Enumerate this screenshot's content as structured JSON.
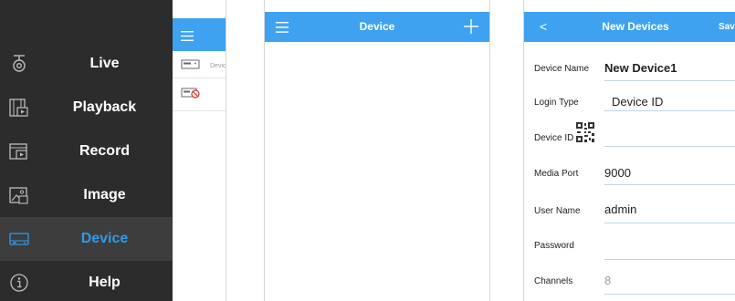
{
  "side_menu": {
    "items": [
      {
        "label": "Live",
        "icon": "live-camera-icon"
      },
      {
        "label": "Playback",
        "icon": "playback-film-icon"
      },
      {
        "label": "Record",
        "icon": "record-video-icon"
      },
      {
        "label": "Image",
        "icon": "image-icon"
      },
      {
        "label": "Device",
        "icon": "device-dvr-icon",
        "active": true
      },
      {
        "label": "Help",
        "icon": "help-icon"
      }
    ],
    "peek_list": [
      {
        "label": "Devic"
      },
      {
        "label": ""
      }
    ]
  },
  "device_list": {
    "title": "Device"
  },
  "new_device": {
    "title": "New Devices",
    "back_label": "<",
    "save_label": "Save",
    "fields": {
      "device_name": {
        "label": "Device Name",
        "value": "New Device1"
      },
      "login_type": {
        "label": "Login Type",
        "value": "Device ID"
      },
      "device_id": {
        "label": "Device ID",
        "value": ""
      },
      "media_port": {
        "label": "Media Port",
        "value": "9000"
      },
      "user_name": {
        "label": "User Name",
        "value": "admin"
      },
      "password": {
        "label": "Password",
        "value": ""
      },
      "channels": {
        "label": "Channels",
        "value": "8"
      }
    }
  },
  "colors": {
    "accent": "#3fa2f1",
    "menu_bg": "#2c2c2c",
    "menu_active_text": "#2e9be8"
  }
}
